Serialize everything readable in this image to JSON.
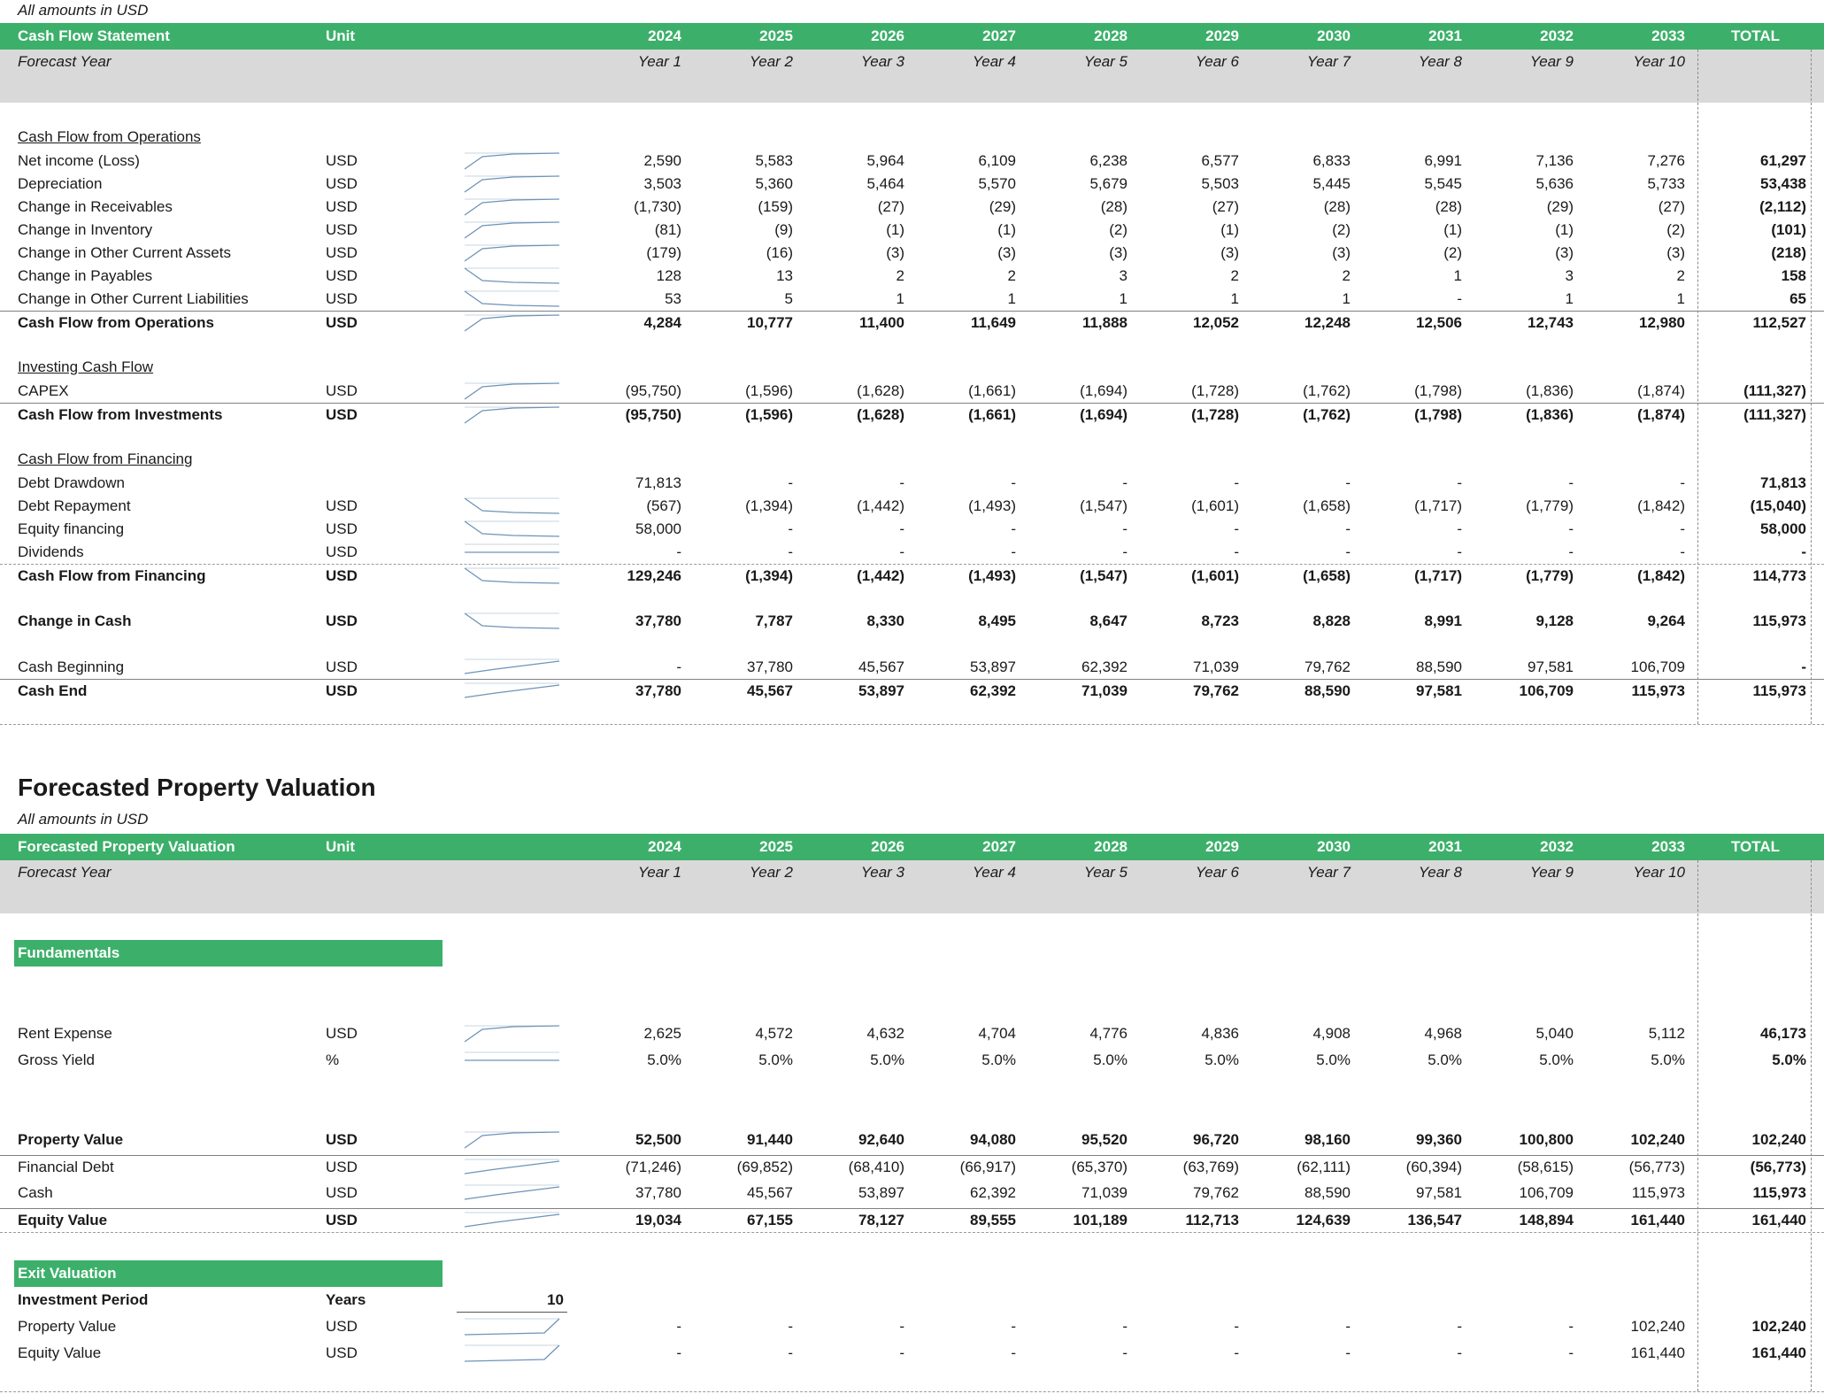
{
  "cf": {
    "note": "All amounts in USD",
    "header": [
      "Cash Flow Statement",
      "Unit",
      "2024",
      "2025",
      "2026",
      "2027",
      "2028",
      "2029",
      "2030",
      "2031",
      "2032",
      "2033",
      "TOTAL"
    ],
    "forecast_label": "Forecast Year",
    "years": [
      "Year 1",
      "Year 2",
      "Year 3",
      "Year 4",
      "Year 5",
      "Year 6",
      "Year 7",
      "Year 8",
      "Year 9",
      "Year 10"
    ],
    "sec_ops": "Cash Flow from Operations",
    "sec_inv": "Investing Cash Flow",
    "sec_fin": "Cash Flow from Financing",
    "rows": [
      {
        "label": "Net income (Loss)",
        "unit": "USD",
        "v": [
          "2,590",
          "5,583",
          "5,964",
          "6,109",
          "6,238",
          "6,577",
          "6,833",
          "6,991",
          "7,136",
          "7,276"
        ],
        "total": "61,297"
      },
      {
        "label": "Depreciation",
        "unit": "USD",
        "v": [
          "3,503",
          "5,360",
          "5,464",
          "5,570",
          "5,679",
          "5,503",
          "5,445",
          "5,545",
          "5,636",
          "5,733"
        ],
        "total": "53,438"
      },
      {
        "label": "Change in Receivables",
        "unit": "USD",
        "v": [
          "(1,730)",
          "(159)",
          "(27)",
          "(29)",
          "(28)",
          "(27)",
          "(28)",
          "(28)",
          "(29)",
          "(27)"
        ],
        "total": "(2,112)"
      },
      {
        "label": "Change in Inventory",
        "unit": "USD",
        "v": [
          "(81)",
          "(9)",
          "(1)",
          "(1)",
          "(2)",
          "(1)",
          "(2)",
          "(1)",
          "(1)",
          "(2)"
        ],
        "total": "(101)"
      },
      {
        "label": "Change in Other Current Assets",
        "unit": "USD",
        "v": [
          "(179)",
          "(16)",
          "(3)",
          "(3)",
          "(3)",
          "(3)",
          "(3)",
          "(2)",
          "(3)",
          "(3)"
        ],
        "total": "(218)"
      },
      {
        "label": "Change in Payables",
        "unit": "USD",
        "v": [
          "128",
          "13",
          "2",
          "2",
          "3",
          "2",
          "2",
          "1",
          "3",
          "2"
        ],
        "total": "158"
      },
      {
        "label": "Change in Other Current Liabilities",
        "unit": "USD",
        "v": [
          "53",
          "5",
          "1",
          "1",
          "1",
          "1",
          "1",
          "-",
          "1",
          "1"
        ],
        "total": "65"
      },
      {
        "label": "Cash Flow from Operations",
        "unit": "USD",
        "v": [
          "4,284",
          "10,777",
          "11,400",
          "11,649",
          "11,888",
          "12,052",
          "12,248",
          "12,506",
          "12,743",
          "12,980"
        ],
        "total": "112,527"
      },
      {
        "label": "CAPEX",
        "unit": "USD",
        "v": [
          "(95,750)",
          "(1,596)",
          "(1,628)",
          "(1,661)",
          "(1,694)",
          "(1,728)",
          "(1,762)",
          "(1,798)",
          "(1,836)",
          "(1,874)"
        ],
        "total": "(111,327)"
      },
      {
        "label": "Cash Flow from Investments",
        "unit": "USD",
        "v": [
          "(95,750)",
          "(1,596)",
          "(1,628)",
          "(1,661)",
          "(1,694)",
          "(1,728)",
          "(1,762)",
          "(1,798)",
          "(1,836)",
          "(1,874)"
        ],
        "total": "(111,327)"
      },
      {
        "label": "Debt Drawdown",
        "unit": "",
        "v": [
          "71,813",
          "-",
          "-",
          "-",
          "-",
          "-",
          "-",
          "-",
          "-",
          "-"
        ],
        "total": "71,813"
      },
      {
        "label": "Debt Repayment",
        "unit": "USD",
        "v": [
          "(567)",
          "(1,394)",
          "(1,442)",
          "(1,493)",
          "(1,547)",
          "(1,601)",
          "(1,658)",
          "(1,717)",
          "(1,779)",
          "(1,842)"
        ],
        "total": "(15,040)"
      },
      {
        "label": "Equity financing",
        "unit": "USD",
        "v": [
          "58,000",
          "-",
          "-",
          "-",
          "-",
          "-",
          "-",
          "-",
          "-",
          "-"
        ],
        "total": "58,000"
      },
      {
        "label": "Dividends",
        "unit": "USD",
        "v": [
          "-",
          "-",
          "-",
          "-",
          "-",
          "-",
          "-",
          "-",
          "-",
          "-"
        ],
        "total": "-"
      },
      {
        "label": "Cash Flow from Financing",
        "unit": "USD",
        "v": [
          "129,246",
          "(1,394)",
          "(1,442)",
          "(1,493)",
          "(1,547)",
          "(1,601)",
          "(1,658)",
          "(1,717)",
          "(1,779)",
          "(1,842)"
        ],
        "total": "114,773"
      },
      {
        "label": "Change in Cash",
        "unit": "USD",
        "v": [
          "37,780",
          "7,787",
          "8,330",
          "8,495",
          "8,647",
          "8,723",
          "8,828",
          "8,991",
          "9,128",
          "9,264"
        ],
        "total": "115,973"
      },
      {
        "label": "Cash Beginning",
        "unit": "USD",
        "v": [
          "-",
          "37,780",
          "45,567",
          "53,897",
          "62,392",
          "71,039",
          "79,762",
          "88,590",
          "97,581",
          "106,709"
        ],
        "total": "-"
      },
      {
        "label": "Cash End",
        "unit": "USD",
        "v": [
          "37,780",
          "45,567",
          "53,897",
          "62,392",
          "71,039",
          "79,762",
          "88,590",
          "97,581",
          "106,709",
          "115,973"
        ],
        "total": "115,973"
      }
    ]
  },
  "pv": {
    "title": "Forecasted Property Valuation",
    "note": "All amounts in USD",
    "header": [
      "Forecasted Property Valuation",
      "Unit",
      "2024",
      "2025",
      "2026",
      "2027",
      "2028",
      "2029",
      "2030",
      "2031",
      "2032",
      "2033",
      "TOTAL"
    ],
    "forecast_label": "Forecast Year",
    "years": [
      "Year 1",
      "Year 2",
      "Year 3",
      "Year 4",
      "Year 5",
      "Year 6",
      "Year 7",
      "Year 8",
      "Year 9",
      "Year 10"
    ],
    "fundamentals": "Fundamentals",
    "exit_valuation": "Exit Valuation",
    "rows": [
      {
        "label": "Rent Expense",
        "unit": "USD",
        "v": [
          "2,625",
          "4,572",
          "4,632",
          "4,704",
          "4,776",
          "4,836",
          "4,908",
          "4,968",
          "5,040",
          "5,112"
        ],
        "total": "46,173"
      },
      {
        "label": "Gross Yield",
        "unit": "%",
        "v": [
          "5.0%",
          "5.0%",
          "5.0%",
          "5.0%",
          "5.0%",
          "5.0%",
          "5.0%",
          "5.0%",
          "5.0%",
          "5.0%"
        ],
        "total": "5.0%"
      },
      {
        "label": "Property Value",
        "unit": "USD",
        "v": [
          "52,500",
          "91,440",
          "92,640",
          "94,080",
          "95,520",
          "96,720",
          "98,160",
          "99,360",
          "100,800",
          "102,240"
        ],
        "total": "102,240"
      },
      {
        "label": "Financial Debt",
        "unit": "USD",
        "v": [
          "(71,246)",
          "(69,852)",
          "(68,410)",
          "(66,917)",
          "(65,370)",
          "(63,769)",
          "(62,111)",
          "(60,394)",
          "(58,615)",
          "(56,773)"
        ],
        "total": "(56,773)"
      },
      {
        "label": "Cash",
        "unit": "USD",
        "v": [
          "37,780",
          "45,567",
          "53,897",
          "62,392",
          "71,039",
          "79,762",
          "88,590",
          "97,581",
          "106,709",
          "115,973"
        ],
        "total": "115,973"
      },
      {
        "label": "Equity Value",
        "unit": "USD",
        "v": [
          "19,034",
          "67,155",
          "78,127",
          "89,555",
          "101,189",
          "112,713",
          "124,639",
          "136,547",
          "148,894",
          "161,440"
        ],
        "total": "161,440"
      }
    ],
    "investment_period": {
      "label": "Investment Period",
      "unit": "Years",
      "value": "10"
    },
    "exit_rows": [
      {
        "label": "Property Value",
        "unit": "USD",
        "v": [
          "-",
          "-",
          "-",
          "-",
          "-",
          "-",
          "-",
          "-",
          "-",
          "102,240"
        ],
        "total": "102,240"
      },
      {
        "label": "Equity Value",
        "unit": "USD",
        "v": [
          "-",
          "-",
          "-",
          "-",
          "-",
          "-",
          "-",
          "-",
          "-",
          "161,440"
        ],
        "total": "161,440"
      }
    ]
  }
}
